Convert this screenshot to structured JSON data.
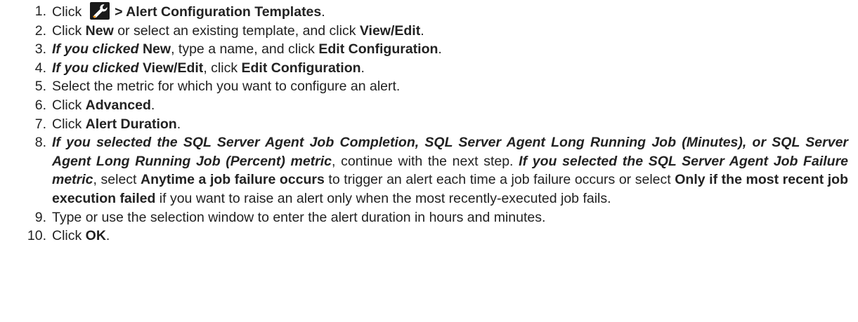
{
  "icons": {
    "settings_button": "wrench-icon"
  },
  "steps": [
    {
      "number": "1.",
      "text_click": "Click",
      "menu_path": "> Alert Configuration Templates",
      "period": "."
    },
    {
      "number": "2.",
      "text_a": "Click ",
      "new": "New",
      "text_b": " or select an existing template, and click ",
      "view_edit": "View/Edit",
      "period": "."
    },
    {
      "number": "3.",
      "condition": "If you clicked",
      "new": "New",
      "text_a": ", type a name, and click ",
      "edit_config": "Edit Configuration",
      "period": "."
    },
    {
      "number": "4.",
      "condition": "If you clicked",
      "view_edit": "View/Edit",
      "text_a": ", click ",
      "edit_config": "Edit Configuration",
      "period": "."
    },
    {
      "number": "5.",
      "text": "Select the metric for which you want to configure an alert."
    },
    {
      "number": "6.",
      "text_a": "Click ",
      "advanced": "Advanced",
      "period": "."
    },
    {
      "number": "7.",
      "text_a": "Click ",
      "alert_duration": "Alert Duration",
      "period": "."
    },
    {
      "number": "8.",
      "condition_a": "If you selected the SQL Server Agent Job Completion, SQL Server Agent Long Running Job (Minutes), or SQL Server Agent Long Running Job (Percent) metric",
      "text_a": ", continue with the next step. ",
      "condition_b": "If you selected the SQL Server Agent Job Failure metric",
      "text_b": ", select ",
      "anytime": "Anytime a job failure occurs",
      "text_c": " to trigger an alert each time a job failure occurs or select ",
      "only_if": "Only if the most recent job execution failed",
      "text_d": " if you want to raise an alert only when the most recently-executed job fails."
    },
    {
      "number": "9.",
      "text": "Type or use the selection window to enter the alert duration in hours and minutes."
    },
    {
      "number": "10.",
      "text_a": "Click ",
      "ok": "OK",
      "period": "."
    }
  ]
}
